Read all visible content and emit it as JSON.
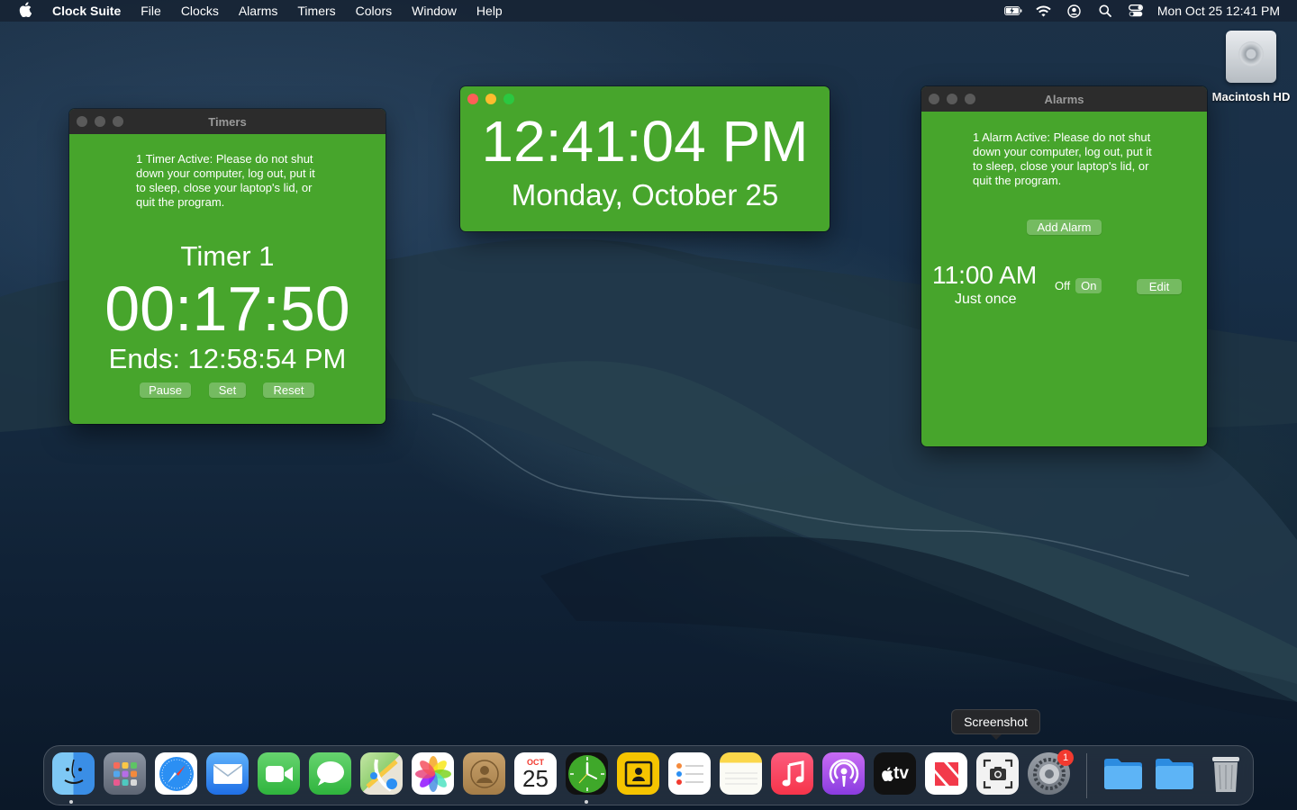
{
  "menubar": {
    "app_name": "Clock Suite",
    "menus": [
      "File",
      "Clocks",
      "Alarms",
      "Timers",
      "Colors",
      "Window",
      "Help"
    ],
    "datetime": "Mon Oct 25  12:41 PM"
  },
  "desktop": {
    "drive_label": "Macintosh HD"
  },
  "timers_window": {
    "title": "Timers",
    "notice": "1 Timer Active: Please do not shut down your computer, log out, put it to sleep, close your laptop's lid, or quit the program.",
    "timer_name": "Timer 1",
    "countdown": "00:17:50",
    "ends": "Ends: 12:58:54 PM",
    "pause_label": "Pause",
    "set_label": "Set",
    "reset_label": "Reset"
  },
  "clock_window": {
    "time": "12:41:04 PM",
    "date": "Monday, October 25"
  },
  "alarms_window": {
    "title": "Alarms",
    "notice": "1 Alarm Active: Please do not shut down your computer, log out, put it to sleep, close your laptop's lid, or quit the program.",
    "add_label": "Add Alarm",
    "alarm_time": "11:00 AM",
    "alarm_repeat": "Just once",
    "toggle_off": "Off",
    "toggle_on": "On",
    "edit_label": "Edit"
  },
  "colors": {
    "window_green": "#47a52c"
  },
  "tooltip": "Screenshot",
  "dock": {
    "calendar_month": "OCT",
    "calendar_day": "25",
    "tv_label": "tv",
    "settings_badge": "1",
    "apps": [
      "finder-icon",
      "launchpad-icon",
      "safari-icon",
      "mail-icon",
      "facetime-icon",
      "messages-icon",
      "maps-icon",
      "photos-icon",
      "contacts-icon",
      "calendar-icon",
      "clock-suite-icon",
      "contacts-card-icon",
      "reminders-icon",
      "notes-icon",
      "music-icon",
      "podcasts-icon",
      "apple-tv-icon",
      "news-icon",
      "screenshot-icon",
      "system-preferences-icon",
      "folder-icon",
      "folder-icon",
      "trash-icon"
    ]
  }
}
